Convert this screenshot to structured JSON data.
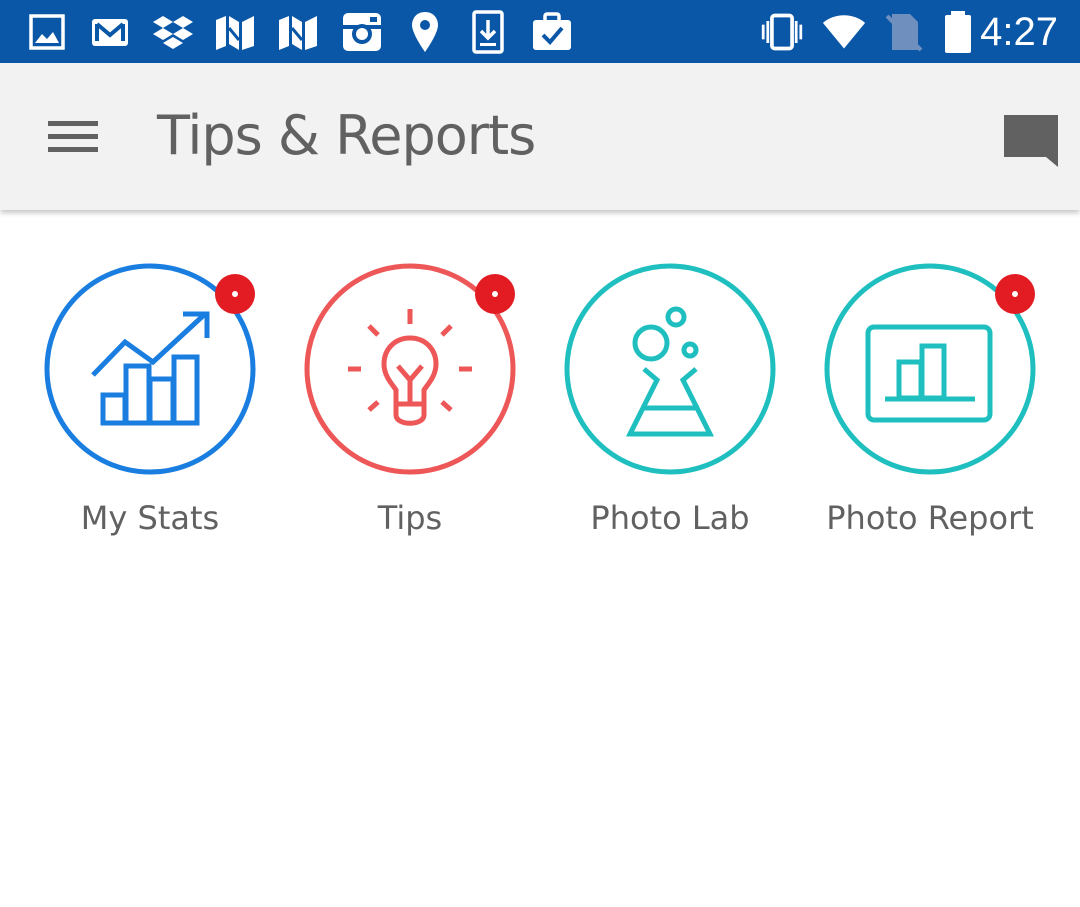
{
  "status_bar": {
    "time": "4:27",
    "background": "#0b57a7",
    "notification_icons": [
      "gallery-icon",
      "gmail-icon",
      "dropbox-icon",
      "maps-icon",
      "maps-icon",
      "instagram-icon",
      "location-pin-icon",
      "download-icon",
      "briefcase-check-icon"
    ],
    "system_icons": [
      "vibrate-icon",
      "wifi-icon",
      "no-sim-icon",
      "battery-icon"
    ]
  },
  "app_bar": {
    "title": "Tips & Reports",
    "menu_icon": "hamburger-menu-icon",
    "action_icon": "chat-icon"
  },
  "tiles": [
    {
      "label": "My Stats",
      "icon": "stats-chart-icon",
      "color": "#1a7de0",
      "badge": true
    },
    {
      "label": "Tips",
      "icon": "lightbulb-icon",
      "color": "#ee5757",
      "badge": true
    },
    {
      "label": "Photo Lab",
      "icon": "flask-icon",
      "color": "#1fbfc0",
      "badge": false
    },
    {
      "label": "Photo Report",
      "icon": "report-chart-icon",
      "color": "#1fbfc0",
      "badge": true
    }
  ],
  "colors": {
    "badge": "#e31b23",
    "label_text": "#616161",
    "app_bar_bg": "#f2f2f2"
  }
}
